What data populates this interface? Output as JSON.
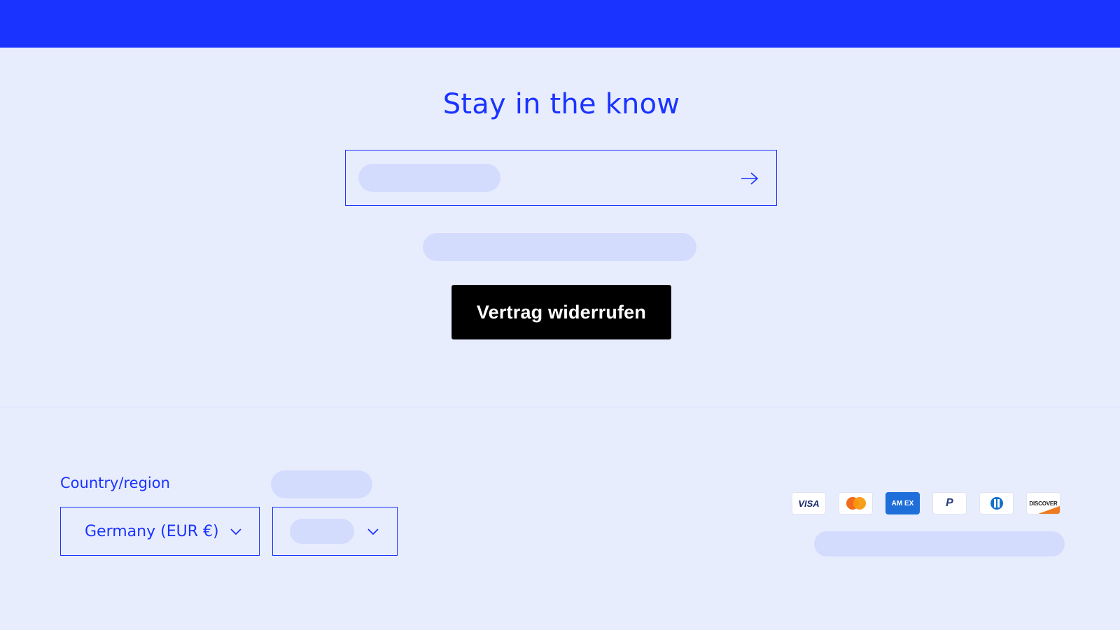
{
  "colors": {
    "brand": "#1a33ff",
    "background": "#e8edfe",
    "placeholder": "#d3dcfd",
    "button_bg": "#000000"
  },
  "newsletter": {
    "title": "Stay in the know",
    "submit_icon": "arrow-right-icon"
  },
  "revoke_button": {
    "label": "Vertrag widerrufen"
  },
  "footer": {
    "country_label": "Country/region",
    "country_value": "Germany (EUR €)",
    "payment_methods": [
      {
        "name": "visa-icon",
        "label": "VISA"
      },
      {
        "name": "mastercard-icon",
        "label": ""
      },
      {
        "name": "amex-icon",
        "label": "AM EX"
      },
      {
        "name": "paypal-icon",
        "label": "P"
      },
      {
        "name": "diners-club-icon",
        "label": ""
      },
      {
        "name": "discover-icon",
        "label": "DISCOVER"
      }
    ]
  }
}
